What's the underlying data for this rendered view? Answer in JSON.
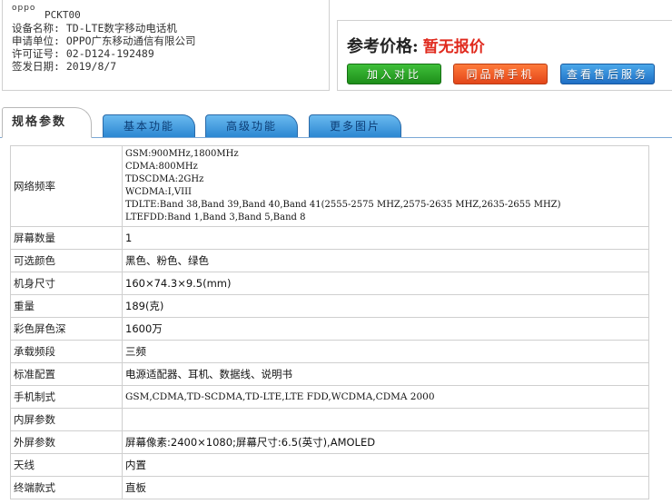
{
  "device": {
    "brand_logo": "oppo",
    "model_code": "PCKT00",
    "lines": [
      "设备名称: TD-LTE数字移动电话机",
      "申请单位: OPPO广东移动通信有限公司",
      "许可证号: 02-D124-192489",
      "签发日期: 2019/8/7"
    ]
  },
  "price": {
    "label": "参考价格:",
    "value": "暂无报价",
    "value_color": "#e02a1e",
    "buttons": {
      "compare": "加入对比",
      "same_brand": "同品牌手机",
      "service": "查看售后服务"
    }
  },
  "tabs": [
    {
      "label": "规格参数",
      "active": true
    },
    {
      "label": "基本功能",
      "active": false
    },
    {
      "label": "高级功能",
      "active": false
    },
    {
      "label": "更多图片",
      "active": false
    }
  ],
  "specs": {
    "network": {
      "label": "网络频率",
      "lines": [
        "GSM:900MHz,1800MHz",
        "CDMA:800MHz",
        "TDSCDMA:2GHz",
        "WCDMA:I,VIII",
        "TDLTE:Band 38,Band 39,Band 40,Band 41(2555-2575 MHZ,2575-2635 MHZ,2635-2655 MHZ)",
        "LTEFDD:Band 1,Band 3,Band 5,Band 8"
      ]
    },
    "rows": [
      {
        "label": "屏幕数量",
        "value": "1"
      },
      {
        "label": "可选颜色",
        "value": "黑色、粉色、绿色"
      },
      {
        "label": "机身尺寸",
        "value": "160×74.3×9.5(mm)"
      },
      {
        "label": "重量",
        "value": "189(克)"
      },
      {
        "label": "彩色屏色深",
        "value": "1600万"
      },
      {
        "label": "承载频段",
        "value": "三频"
      },
      {
        "label": "标准配置",
        "value": "电源适配器、耳机、数据线、说明书"
      },
      {
        "label": "手机制式",
        "value": "GSM,CDMA,TD-SCDMA,TD-LTE,LTE FDD,WCDMA,CDMA 2000"
      },
      {
        "label": "内屏参数",
        "value": ""
      },
      {
        "label": "外屏参数",
        "value": "屏幕像素:2400×1080;屏幕尺寸:6.5(英寸),AMOLED"
      },
      {
        "label": "天线",
        "value": "内置"
      },
      {
        "label": "终端款式",
        "value": "直板"
      }
    ]
  }
}
